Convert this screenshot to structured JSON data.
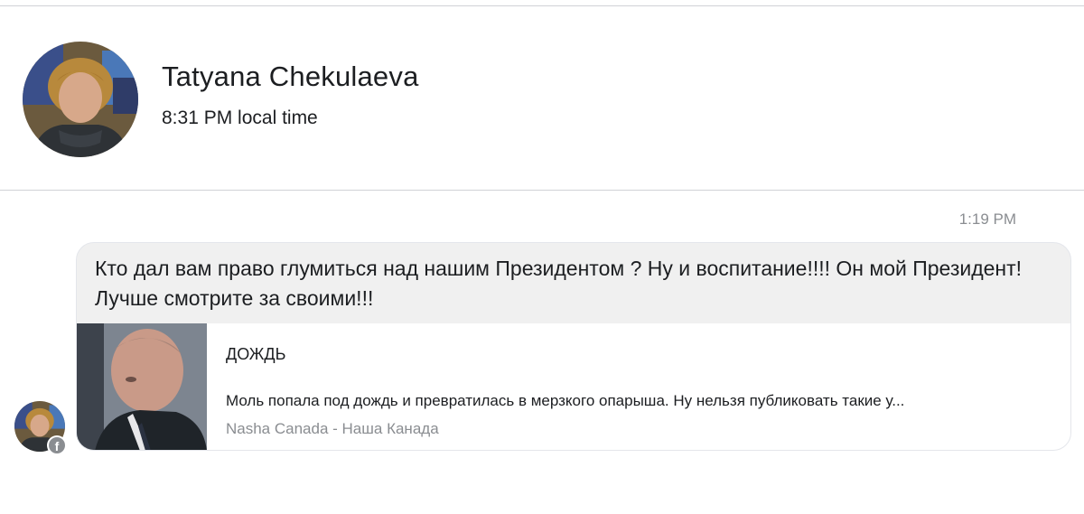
{
  "contact": {
    "name": "Tatyana Chekulaeva",
    "local_time": "8:31 PM local time"
  },
  "conversation": {
    "timestamp": "1:19 PM",
    "message": {
      "text": "Кто дал вам право глумиться над нашим Президентом ? Ну и воспитание!!!! Он мой Президент! Лучше смотрите за своими!!!",
      "link_preview": {
        "source_label": "ДОЖДЬ",
        "description": "Моль попала под дождь и превратилась в мерзкого опарыша. Ну нельзя публиковать такие  у...",
        "site_name": "Nasha Canada - Наша Канада"
      }
    },
    "sender_badge_icon": "facebook-icon"
  }
}
